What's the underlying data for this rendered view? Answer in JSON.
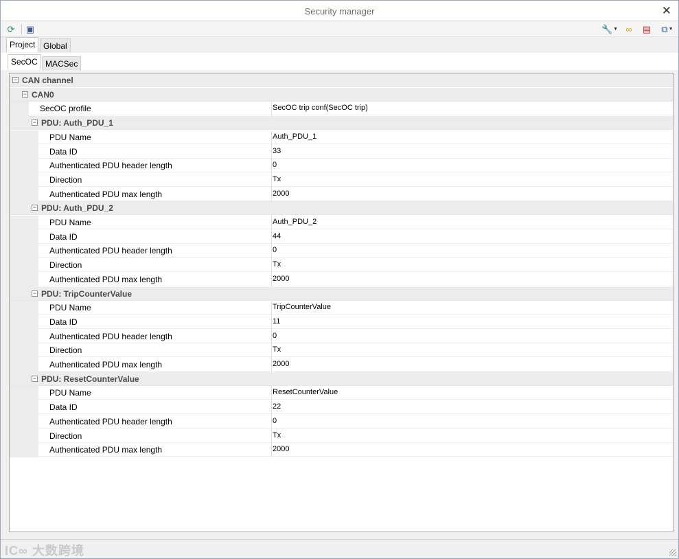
{
  "window": {
    "title": "Security manager",
    "close_glyph": "✕"
  },
  "toolbar": {
    "left": [
      {
        "name": "refresh-icon",
        "glyph": "⟳",
        "color": "#2e8b57"
      },
      {
        "name": "select-icon",
        "glyph": "▣",
        "color": "#3a5a8c"
      }
    ],
    "right": [
      {
        "name": "wrench-icon",
        "glyph": "🔧",
        "color": "#2f5fa0",
        "dropdown": true
      },
      {
        "name": "link-icon",
        "glyph": "∞",
        "color": "#e0a020",
        "dropdown": false
      },
      {
        "name": "delete-icon",
        "glyph": "▤",
        "color": "#c03030",
        "dropdown": false
      },
      {
        "name": "export-icon",
        "glyph": "⧉",
        "color": "#2f5fa0",
        "dropdown": true
      }
    ]
  },
  "tabs_top": [
    {
      "label": "Project",
      "active": true
    },
    {
      "label": "Global",
      "active": false
    }
  ],
  "tabs_sub": [
    {
      "label": "SecOC",
      "active": true
    },
    {
      "label": "MACSec",
      "active": false
    }
  ],
  "tree": {
    "channel_label": "CAN channel",
    "bus_label": "CAN0",
    "profile": {
      "name": "SecOC profile",
      "value": "SecOC trip conf(SecOC trip)"
    },
    "pdus": [
      {
        "title": "PDU: Auth_PDU_1",
        "props": [
          {
            "name": "PDU Name",
            "value": "Auth_PDU_1"
          },
          {
            "name": "Data ID",
            "value": "33"
          },
          {
            "name": "Authenticated PDU header length",
            "value": "0"
          },
          {
            "name": "Direction",
            "value": "Tx"
          },
          {
            "name": "Authenticated PDU max length",
            "value": "2000"
          }
        ]
      },
      {
        "title": "PDU: Auth_PDU_2",
        "props": [
          {
            "name": "PDU Name",
            "value": "Auth_PDU_2"
          },
          {
            "name": "Data ID",
            "value": "44"
          },
          {
            "name": "Authenticated PDU header length",
            "value": "0"
          },
          {
            "name": "Direction",
            "value": "Tx"
          },
          {
            "name": "Authenticated PDU max length",
            "value": "2000"
          }
        ]
      },
      {
        "title": "PDU: TripCounterValue",
        "props": [
          {
            "name": "PDU Name",
            "value": "TripCounterValue"
          },
          {
            "name": "Data ID",
            "value": "11"
          },
          {
            "name": "Authenticated PDU header length",
            "value": "0"
          },
          {
            "name": "Direction",
            "value": "Tx"
          },
          {
            "name": "Authenticated PDU max length",
            "value": "2000"
          }
        ]
      },
      {
        "title": "PDU: ResetCounterValue",
        "props": [
          {
            "name": "PDU Name",
            "value": "ResetCounterValue"
          },
          {
            "name": "Data ID",
            "value": "22"
          },
          {
            "name": "Authenticated PDU header length",
            "value": "0"
          },
          {
            "name": "Direction",
            "value": "Tx"
          },
          {
            "name": "Authenticated PDU max length",
            "value": "2000"
          }
        ]
      }
    ]
  },
  "statusbar": {
    "watermark": "IC∞ 大数跨境"
  }
}
